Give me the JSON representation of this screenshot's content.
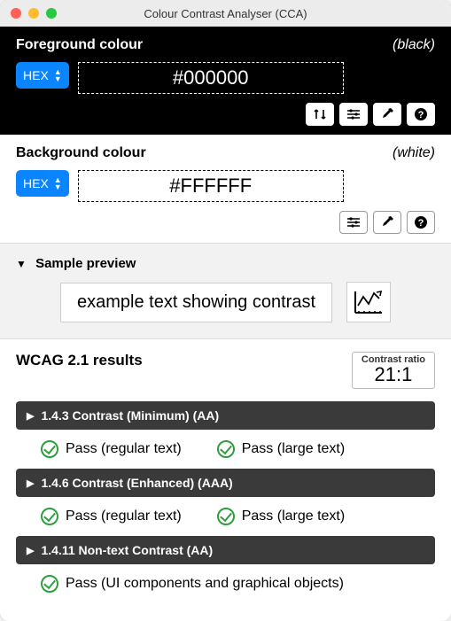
{
  "window": {
    "title": "Colour Contrast Analyser (CCA)"
  },
  "foreground": {
    "label": "Foreground colour",
    "colorName": "(black)",
    "format": "HEX",
    "value": "#000000"
  },
  "background": {
    "label": "Background colour",
    "colorName": "(white)",
    "format": "HEX",
    "value": "#FFFFFF"
  },
  "preview": {
    "heading": "Sample preview",
    "sampleText": "example text showing contrast"
  },
  "results": {
    "heading": "WCAG 2.1 results",
    "ratioLabel": "Contrast ratio",
    "ratioValue": "21:1",
    "criteria": [
      {
        "title": "1.4.3 Contrast (Minimum) (AA)",
        "passes": [
          "Pass (regular text)",
          "Pass (large text)"
        ]
      },
      {
        "title": "1.4.6 Contrast (Enhanced) (AAA)",
        "passes": [
          "Pass (regular text)",
          "Pass (large text)"
        ]
      },
      {
        "title": "1.4.11 Non-text Contrast (AA)",
        "passes": [
          "Pass (UI components and graphical objects)"
        ]
      }
    ]
  }
}
